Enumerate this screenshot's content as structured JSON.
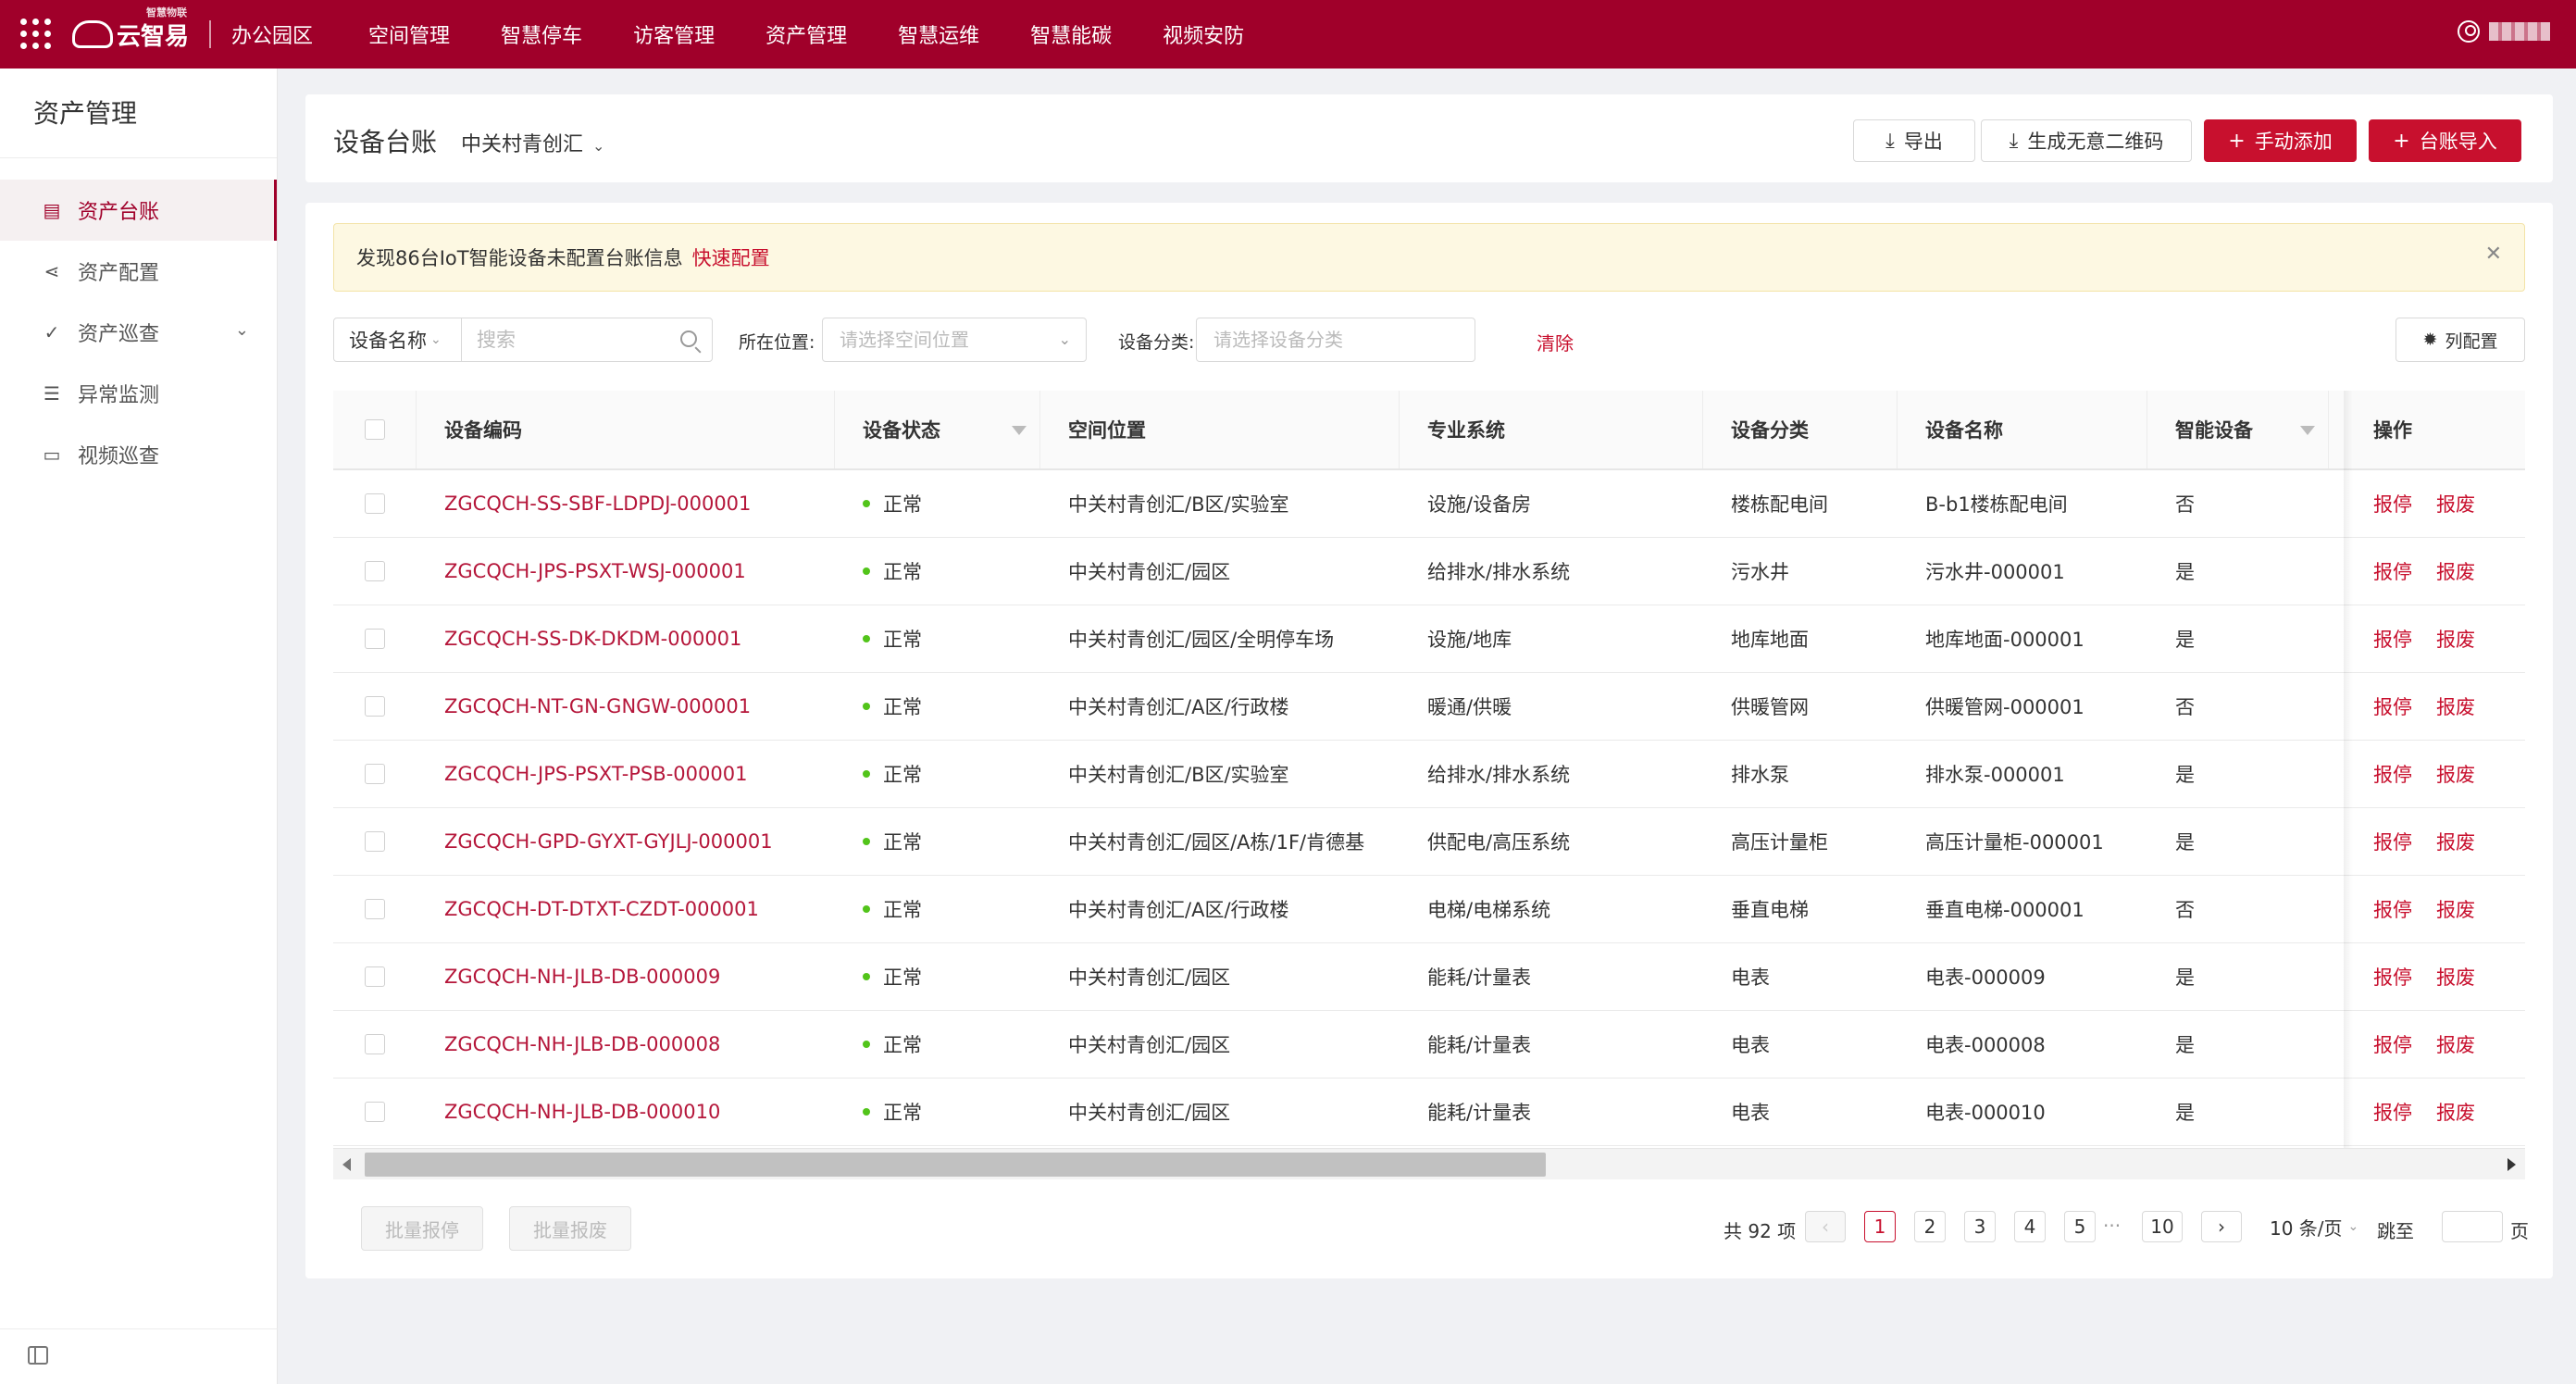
{
  "topbar": {
    "logo_text": "云智易",
    "logo_small": "智慧物联",
    "park": "办公园区",
    "nav": [
      "空间管理",
      "智慧停车",
      "访客管理",
      "资产管理",
      "智慧运维",
      "智慧能碳",
      "视频安防"
    ]
  },
  "sidebar": {
    "title": "资产管理",
    "items": [
      {
        "label": "资产台账",
        "icon": "ledger-icon",
        "active": true
      },
      {
        "label": "资产配置",
        "icon": "share-icon",
        "active": false
      },
      {
        "label": "资产巡查",
        "icon": "check-circle-icon",
        "active": false,
        "expandable": true
      },
      {
        "label": "异常监测",
        "icon": "list-icon",
        "active": false
      },
      {
        "label": "视频巡查",
        "icon": "video-icon",
        "active": false
      }
    ]
  },
  "header": {
    "title": "设备台账",
    "site": "中关村青创汇",
    "export_label": "导出",
    "qrcode_label": "生成无意二维码",
    "add_label": "手动添加",
    "import_label": "台账导入"
  },
  "alert": {
    "text": "发现86台IoT智能设备未配置台账信息",
    "link": "快速配置"
  },
  "filters": {
    "field_select": "设备名称",
    "search_placeholder": "搜索",
    "location_label": "所在位置:",
    "location_placeholder": "请选择空间位置",
    "category_label": "设备分类:",
    "category_placeholder": "请选择设备分类",
    "clear_label": "清除",
    "column_config_label": "列配置"
  },
  "table": {
    "headers": [
      "设备编码",
      "设备状态",
      "空间位置",
      "专业系统",
      "设备分类",
      "设备名称",
      "智能设备",
      "操作"
    ],
    "rows": [
      {
        "code": "ZGCQCH-SS-SBF-LDPDJ-000001",
        "status": "正常",
        "location": "中关村青创汇/B区/实验室",
        "system": "设施/设备房",
        "category": "楼栋配电间",
        "name": "B-b1楼栋配电间",
        "smart": "否"
      },
      {
        "code": "ZGCQCH-JPS-PSXT-WSJ-000001",
        "status": "正常",
        "location": "中关村青创汇/园区",
        "system": "给排水/排水系统",
        "category": "污水井",
        "name": "污水井-000001",
        "smart": "是"
      },
      {
        "code": "ZGCQCH-SS-DK-DKDM-000001",
        "status": "正常",
        "location": "中关村青创汇/园区/全明停车场",
        "system": "设施/地库",
        "category": "地库地面",
        "name": "地库地面-000001",
        "smart": "是"
      },
      {
        "code": "ZGCQCH-NT-GN-GNGW-000001",
        "status": "正常",
        "location": "中关村青创汇/A区/行政楼",
        "system": "暖通/供暖",
        "category": "供暖管网",
        "name": "供暖管网-000001",
        "smart": "否"
      },
      {
        "code": "ZGCQCH-JPS-PSXT-PSB-000001",
        "status": "正常",
        "location": "中关村青创汇/B区/实验室",
        "system": "给排水/排水系统",
        "category": "排水泵",
        "name": "排水泵-000001",
        "smart": "是"
      },
      {
        "code": "ZGCQCH-GPD-GYXT-GYJLJ-000001",
        "status": "正常",
        "location": "中关村青创汇/园区/A栋/1F/肯德基",
        "system": "供配电/高压系统",
        "category": "高压计量柜",
        "name": "高压计量柜-000001",
        "smart": "是"
      },
      {
        "code": "ZGCQCH-DT-DTXT-CZDT-000001",
        "status": "正常",
        "location": "中关村青创汇/A区/行政楼",
        "system": "电梯/电梯系统",
        "category": "垂直电梯",
        "name": "垂直电梯-000001",
        "smart": "否"
      },
      {
        "code": "ZGCQCH-NH-JLB-DB-000009",
        "status": "正常",
        "location": "中关村青创汇/园区",
        "system": "能耗/计量表",
        "category": "电表",
        "name": "电表-000009",
        "smart": "是"
      },
      {
        "code": "ZGCQCH-NH-JLB-DB-000008",
        "status": "正常",
        "location": "中关村青创汇/园区",
        "system": "能耗/计量表",
        "category": "电表",
        "name": "电表-000008",
        "smart": "是"
      },
      {
        "code": "ZGCQCH-NH-JLB-DB-000010",
        "status": "正常",
        "location": "中关村青创汇/园区",
        "system": "能耗/计量表",
        "category": "电表",
        "name": "电表-000010",
        "smart": "是"
      }
    ],
    "op_stop": "报停",
    "op_scrap": "报废"
  },
  "footer": {
    "bulk_stop": "批量报停",
    "bulk_scrap": "批量报废",
    "total": "共 92 项",
    "pages": [
      "1",
      "2",
      "3",
      "4",
      "5"
    ],
    "ellipsis": "···",
    "last_page": "10",
    "current_page": "1",
    "page_size": "10 条/页",
    "jump_label": "跳至",
    "page_unit": "页"
  },
  "colors": {
    "brand": "#a0002a",
    "accent": "#c8102e",
    "status_ok": "#52c41a"
  }
}
